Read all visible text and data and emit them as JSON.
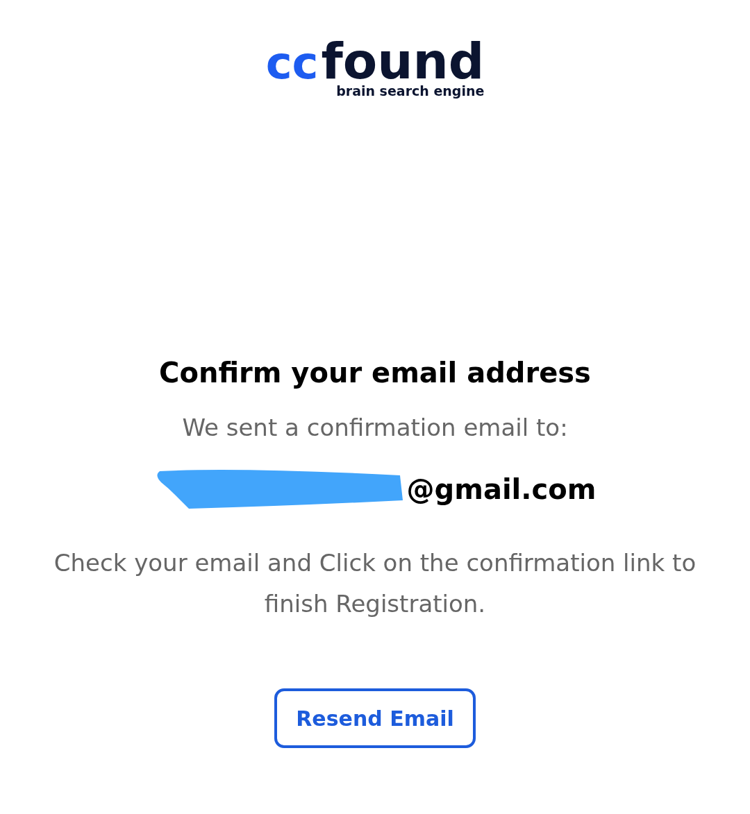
{
  "logo": {
    "mark": "cc",
    "name": "found",
    "tagline": "brain search engine"
  },
  "heading": "Confirm your email address",
  "sent_text": "We sent a confirmation email to:",
  "email": {
    "redacted": true,
    "domain": "@gmail.com"
  },
  "instructions": "Check your email and Click on the confirmation link to finish Registration.",
  "resend_button": "Resend Email"
}
